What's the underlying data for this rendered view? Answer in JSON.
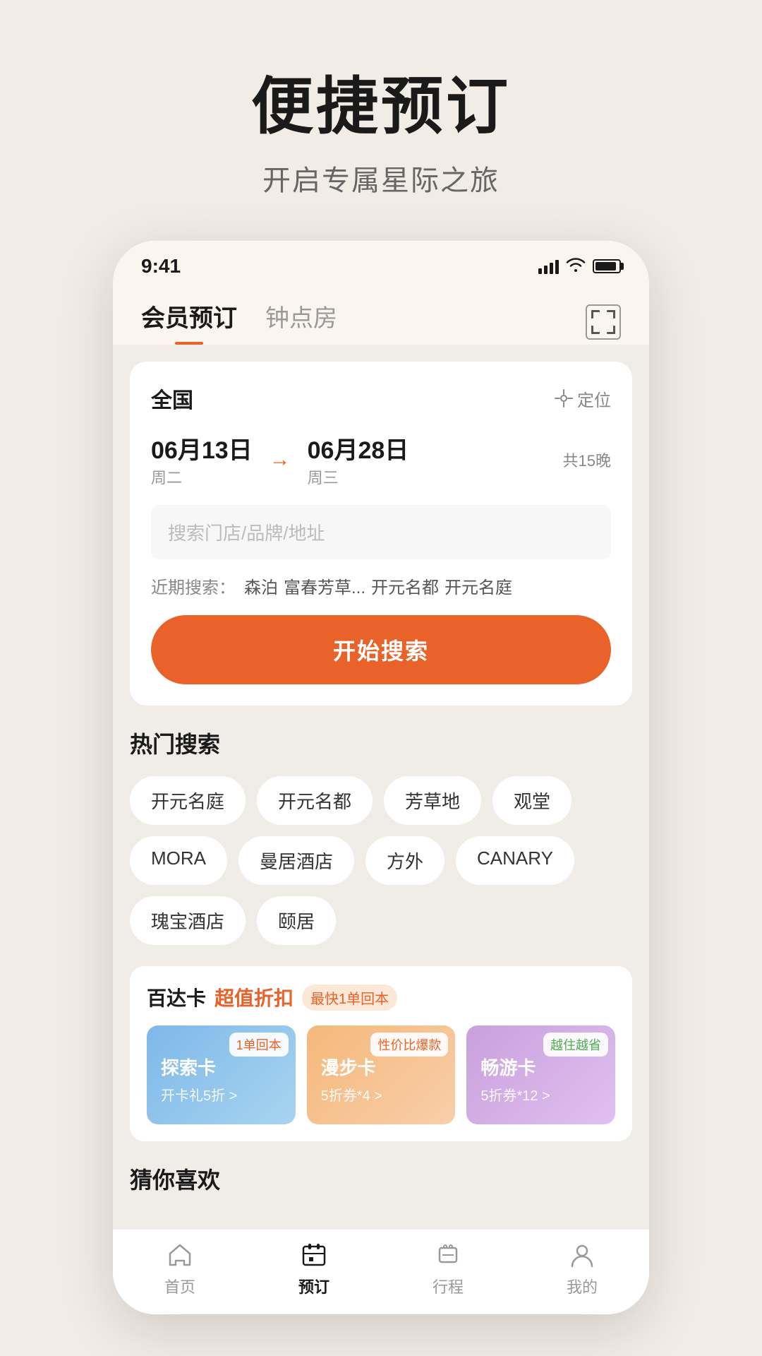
{
  "header": {
    "title": "便捷预订",
    "subtitle": "开启专属星际之旅"
  },
  "statusBar": {
    "time": "9:41"
  },
  "navTabs": {
    "active": "会员预订",
    "tabs": [
      "会员预订",
      "钟点房"
    ]
  },
  "searchCard": {
    "location": "全国",
    "locateLabel": "定位",
    "dateFrom": "06月13日",
    "dateDayFrom": "周二",
    "dateTo": "06月28日",
    "dateDayTo": "周三",
    "nights": "共15晚",
    "searchPlaceholder": "搜索门店/品牌/地址",
    "recentLabel": "近期搜索：",
    "recentTags": [
      "森泊",
      "富春芳草...",
      "开元名都",
      "开元名庭"
    ],
    "searchButtonLabel": "开始搜索"
  },
  "hotSearch": {
    "title": "热门搜索",
    "tags": [
      "开元名庭",
      "开元名都",
      "芳草地",
      "观堂",
      "MORA",
      "曼居酒店",
      "方外",
      "CANARY",
      "瑰宝酒店",
      "颐居"
    ]
  },
  "baidaka": {
    "title": "百达卡",
    "subtitle": "超值折扣",
    "badge": "最快1单回本",
    "cards": [
      {
        "name": "探索卡",
        "desc": "开卡礼5折 >",
        "badge": "1单回本",
        "colorClass": "blue"
      },
      {
        "name": "漫步卡",
        "desc": "5折券*4 >",
        "badge": "性价比爆款",
        "colorClass": "orange"
      },
      {
        "name": "畅游卡",
        "desc": "5折券*12 >",
        "badge": "越住越省",
        "colorClass": "purple"
      }
    ]
  },
  "guessSection": {
    "title": "猜你喜欢"
  },
  "bottomNav": {
    "items": [
      {
        "label": "首页",
        "icon": "home",
        "active": false
      },
      {
        "label": "预订",
        "icon": "booking",
        "active": true
      },
      {
        "label": "行程",
        "icon": "trip",
        "active": false
      },
      {
        "label": "我的",
        "icon": "profile",
        "active": false
      }
    ]
  }
}
